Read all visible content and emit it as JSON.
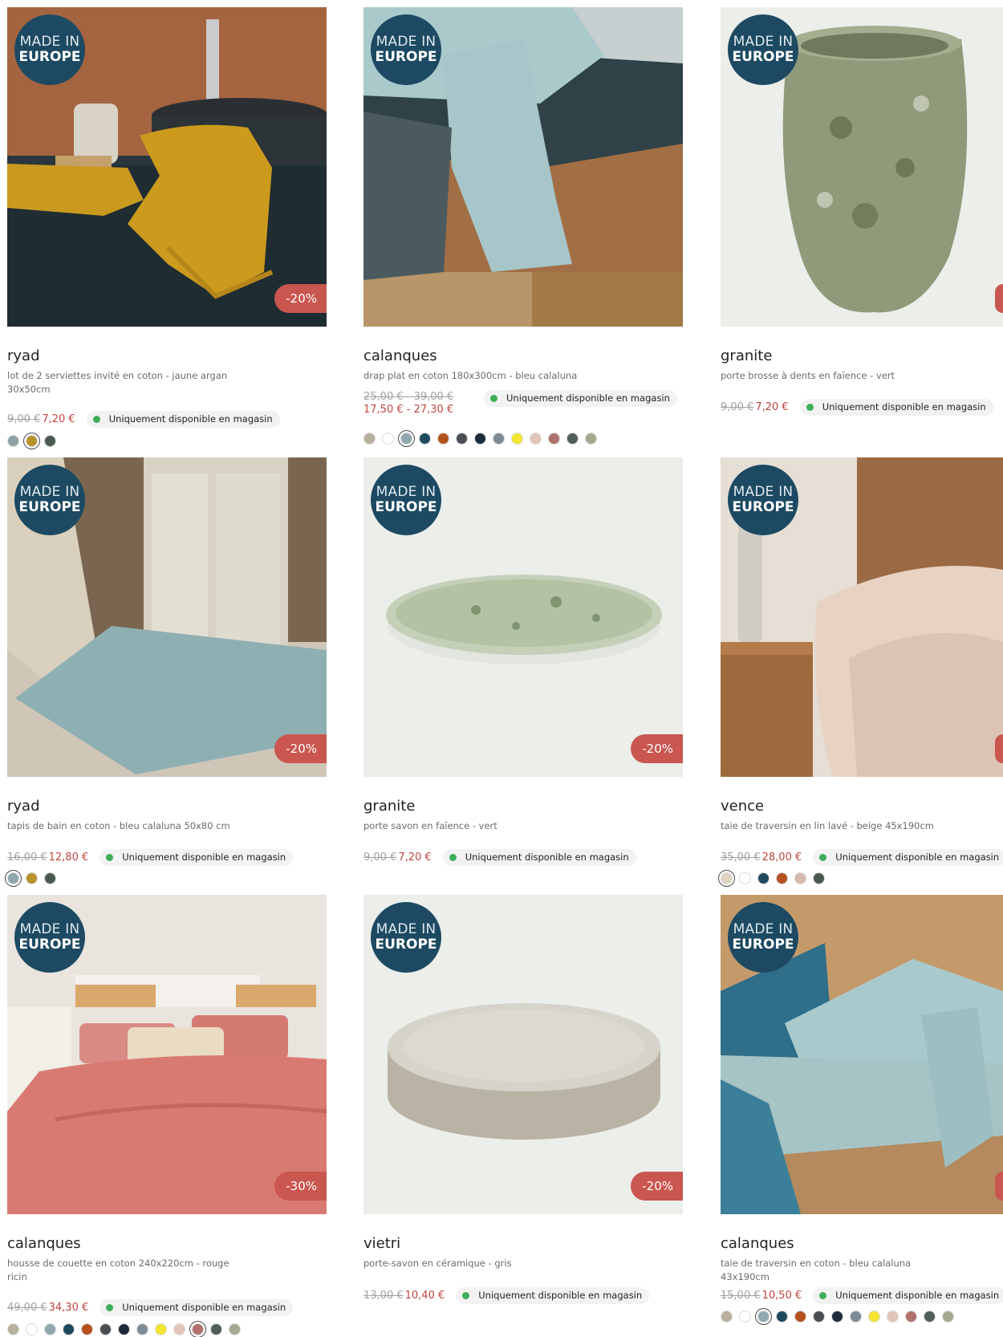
{
  "badge": {
    "line1": "MADE IN",
    "line2": "EUROPE"
  },
  "availability_label": "Uniquement disponible en magasin",
  "products": [
    {
      "name": "ryad",
      "desc_lines": [
        "lot de 2 serviettes invité en coton - jaune argan",
        "30x50cm"
      ],
      "old_price": "9,00 €",
      "new_price": "7,20 €",
      "discount": "-20%",
      "swatches": [
        "#8fa3a6",
        "#b8922a",
        "#4a5a50"
      ],
      "selected_swatch": 1
    },
    {
      "name": "calanques",
      "desc_lines": [
        "drap plat en coton 180x300cm - bleu calaluna"
      ],
      "old_price": "25,00 € - 39,00 €",
      "new_price": "17,50 € - 27,30 €",
      "discount": "",
      "swatches": [
        "#b7b09c",
        "#ffffff",
        "#8fa7ad",
        "#1f4a5e",
        "#b4501e",
        "#4a4f55",
        "#1c2a3a",
        "#7d8b96",
        "#f3e531",
        "#e3c4b9",
        "#b0706c",
        "#4f5e56",
        "#a6a990"
      ],
      "selected_swatch": 2
    },
    {
      "name": "granite",
      "desc_lines": [
        "porte brosse à dents en faïence - vert"
      ],
      "old_price": "9,00 €",
      "new_price": "7,20 €",
      "discount": "",
      "swatches": [],
      "selected_swatch": -1
    },
    {
      "name": "ryad",
      "desc_lines": [
        "tapis de bain en coton - bleu calaluna 50x80 cm"
      ],
      "old_price": "16,00 €",
      "new_price": "12,80 €",
      "discount": "-20%",
      "swatches": [
        "#8fa7ad",
        "#b8922a",
        "#4a5a50"
      ],
      "selected_swatch": 0
    },
    {
      "name": "granite",
      "desc_lines": [
        "porte savon en faïence - vert"
      ],
      "old_price": "9,00 €",
      "new_price": "7,20 €",
      "discount": "-20%",
      "swatches": [],
      "selected_swatch": -1
    },
    {
      "name": "vence",
      "desc_lines": [
        "taie de traversin en lin lavé - beige 45x190cm"
      ],
      "old_price": "35,00 €",
      "new_price": "28,00 €",
      "discount": "",
      "swatches": [
        "#e0d3c2",
        "#ffffff",
        "#1f4a5e",
        "#b4501e",
        "#d9b8ad",
        "#4a5a50"
      ],
      "selected_swatch": 0
    },
    {
      "name": "calanques",
      "desc_lines": [
        "housse de couette en coton 240x220cm - rouge",
        "ricin"
      ],
      "old_price": "49,00 €",
      "new_price": "34,30 €",
      "discount": "-30%",
      "swatches": [
        "#b7b09c",
        "#ffffff",
        "#8fa7ad",
        "#1f4a5e",
        "#b4501e",
        "#4a4f55",
        "#1c2a3a",
        "#7d8b96",
        "#f3e531",
        "#e3c4b9",
        "#b0706c",
        "#4f5e56",
        "#a6a990"
      ],
      "selected_swatch": 10
    },
    {
      "name": "vietri",
      "desc_lines": [
        "porte-savon en céramique - gris"
      ],
      "old_price": "13,00 €",
      "new_price": "10,40 €",
      "discount": "-20%",
      "swatches": [],
      "selected_swatch": -1
    },
    {
      "name": "calanques",
      "desc_lines": [
        "taie de traversin en coton - bleu calaluna 43x190cm"
      ],
      "old_price": "15,00 €",
      "new_price": "10,50 €",
      "discount": "",
      "swatches": [
        "#b7b09c",
        "#ffffff",
        "#8fa7ad",
        "#1f4a5e",
        "#b4501e",
        "#4a4f55",
        "#1c2a3a",
        "#7d8b96",
        "#f3e531",
        "#e3c4b9",
        "#b0706c",
        "#4f5e56",
        "#a6a990"
      ],
      "selected_swatch": 2
    }
  ]
}
